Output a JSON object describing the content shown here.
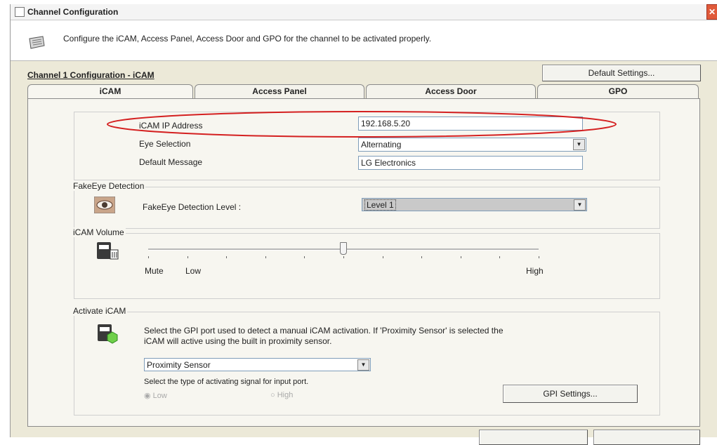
{
  "window": {
    "title": "Channel Configuration",
    "close": "✕"
  },
  "header": {
    "description": "Configure the iCAM, Access Panel, Access Door and GPO for the channel to be activated properly."
  },
  "config": {
    "section_label": "Channel 1 Configuration  - iCAM",
    "default_settings_label": "Default Settings..."
  },
  "tabs": [
    {
      "label": "iCAM",
      "active": true
    },
    {
      "label": "Access Panel",
      "active": false
    },
    {
      "label": "Access Door",
      "active": false
    },
    {
      "label": "GPO",
      "active": false
    }
  ],
  "icam": {
    "ip_label": "iCAM IP Address",
    "ip_value": "192.168.5.20",
    "eye_label": "Eye Selection",
    "eye_value": "Alternating",
    "message_label": "Default Message",
    "message_value": "LG Electronics"
  },
  "fakeeye": {
    "group_title": "FakeEye Detection",
    "level_label": "FakeEye Detection Level :",
    "level_value": "Level 1"
  },
  "volume": {
    "group_title": "iCAM Volume",
    "labels": {
      "mute": "Mute",
      "low": "Low",
      "high": "High"
    },
    "level_fraction": 0.5
  },
  "activate": {
    "group_title": "Activate iCAM",
    "description_line1": "Select the GPI port used to detect a manual iCAM activation.  If 'Proximity Sensor' is selected the",
    "description_line2": "iCAM will active using the built in proximity sensor.",
    "port_value": "Proximity Sensor",
    "signal_label": "Select the type of activating signal for input port.",
    "radio_low": "Low",
    "radio_high": "High",
    "gpi_settings_label": "GPI Settings..."
  },
  "colors": {
    "highlight_ellipse": "#d42020",
    "dialog_bg": "#ece9d8",
    "panel_bg": "#f7f6f0",
    "selected_combo": "#c9c9c9"
  }
}
